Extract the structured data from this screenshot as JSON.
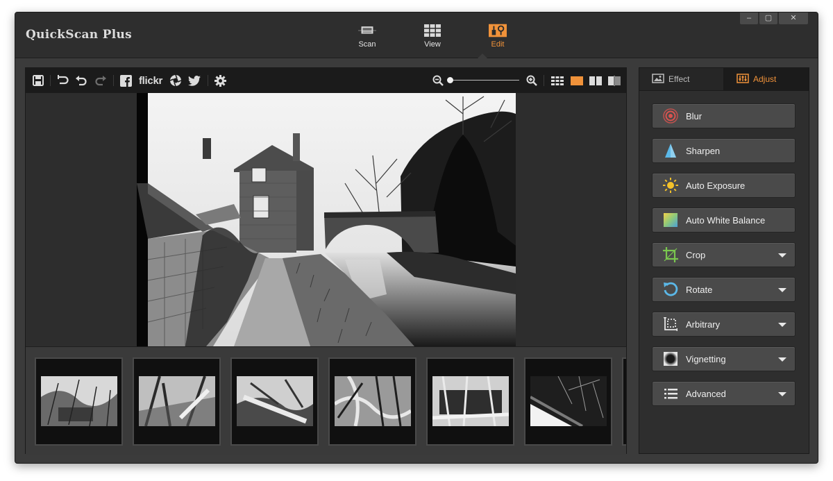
{
  "app": {
    "title": "QuickScan Plus"
  },
  "window_controls": {
    "minimize": "–",
    "maximize": "▢",
    "close": "✕"
  },
  "modes": [
    {
      "label": "Scan",
      "icon": "scanner-icon",
      "active": false
    },
    {
      "label": "View",
      "icon": "grid-view-icon",
      "active": false
    },
    {
      "label": "Edit",
      "icon": "edit-tools-icon",
      "active": true
    }
  ],
  "toolbar": {
    "icons": [
      "save-icon",
      "undo-all-icon",
      "undo-icon",
      "redo-icon",
      "facebook-icon",
      "flickr-logo",
      "photos-icon",
      "twitter-icon",
      "settings-icon",
      "zoom-out-icon",
      "zoom-in-icon",
      "grid-layout-icon",
      "single-view-icon",
      "split-view-icon",
      "compare-view-icon"
    ],
    "flickr_label": "flickr",
    "zoom_level": 0
  },
  "panel": {
    "tabs": [
      {
        "label": "Effect",
        "icon": "image-icon",
        "active": false
      },
      {
        "label": "Adjust",
        "icon": "sliders-icon",
        "active": true
      }
    ],
    "adjustments": [
      {
        "label": "Blur",
        "icon": "blur-icon",
        "dropdown": false
      },
      {
        "label": "Sharpen",
        "icon": "sharpen-icon",
        "dropdown": false
      },
      {
        "label": "Auto Exposure",
        "icon": "sun-icon",
        "dropdown": false
      },
      {
        "label": "Auto White Balance",
        "icon": "white-balance-icon",
        "dropdown": false
      },
      {
        "label": "Crop",
        "icon": "crop-icon",
        "dropdown": true
      },
      {
        "label": "Rotate",
        "icon": "rotate-icon",
        "dropdown": true
      },
      {
        "label": "Arbitrary",
        "icon": "arbitrary-icon",
        "dropdown": true
      },
      {
        "label": "Vignetting",
        "icon": "vignette-icon",
        "dropdown": true
      },
      {
        "label": "Advanced",
        "icon": "list-icon",
        "dropdown": true
      }
    ]
  },
  "colors": {
    "accent": "#f0923a",
    "window": "#3b3b3b",
    "toolbar": "#1b1b1b",
    "button": "#4a4a4a"
  },
  "filmstrip": {
    "count": 6
  }
}
